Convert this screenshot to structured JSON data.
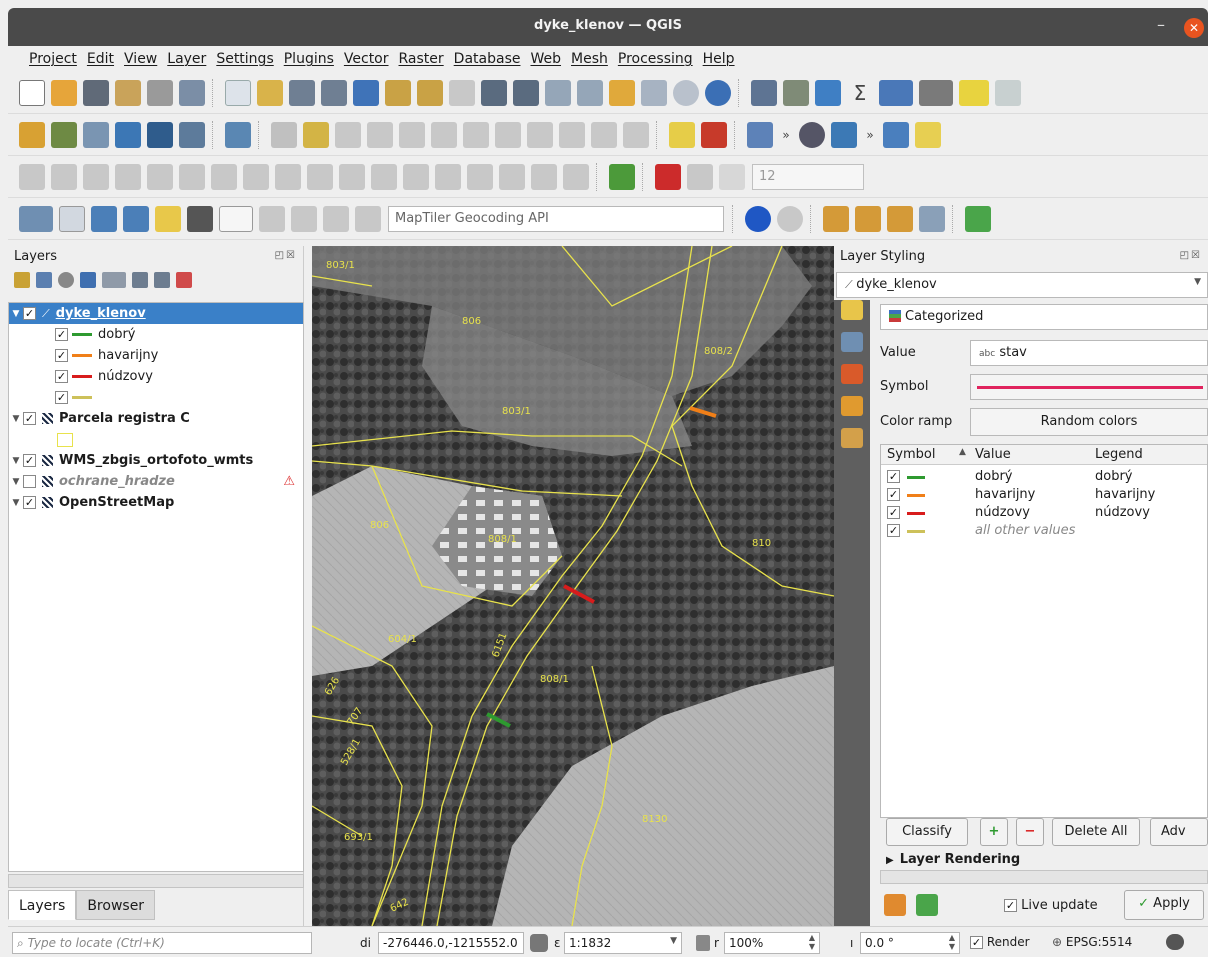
{
  "window": {
    "title": "dyke_klenov — QGIS",
    "minimize": "–",
    "close": "✕"
  },
  "menu": [
    "Project",
    "Edit",
    "View",
    "Layer",
    "Settings",
    "Plugins",
    "Vector",
    "Raster",
    "Database",
    "Web",
    "Mesh",
    "Processing",
    "Help"
  ],
  "toolbar": {
    "geocoder_placeholder": "MapTiler Geocoding API",
    "snap_tolerance": "12",
    "overflow": "»"
  },
  "layers_panel": {
    "title": "Layers",
    "dock_buttons": "◰☒",
    "check": "✓",
    "tree": [
      {
        "label": "dyke_klenov",
        "checked": true,
        "selected": true
      },
      {
        "label": "dobrý",
        "checked": true,
        "color": "#2e9a30"
      },
      {
        "label": "havarijny",
        "checked": true,
        "color": "#f07f18"
      },
      {
        "label": "núdzovy",
        "checked": true,
        "color": "#d81c1c"
      },
      {
        "label": "",
        "checked": true,
        "color": "#cdc15a"
      },
      {
        "label": "Parcela registra C",
        "checked": true
      },
      {
        "label": "WMS_zbgis_ortofoto_wmts",
        "checked": true
      },
      {
        "label": "ochrane_hradze",
        "checked": false,
        "warning": "⚠"
      },
      {
        "label": "OpenStreetMap",
        "checked": true
      }
    ],
    "tabs": [
      "Layers",
      "Browser"
    ]
  },
  "map": {
    "parcel_labels": [
      "803/1",
      "806",
      "803/1",
      "808/2",
      "806",
      "808/1",
      "810",
      "6151",
      "604/1",
      "808/1",
      "626",
      "707",
      "528/1",
      "8130",
      "693/1",
      "642"
    ],
    "segment_colors": {
      "good": "#2e9a30",
      "critical": "#f07f18",
      "emergency": "#d81c1c",
      "parcel": "#e8e24c"
    }
  },
  "styling_panel": {
    "title": "Layer Styling",
    "dock_buttons": "◰☒",
    "layer": "dyke_klenov",
    "renderer": "Categorized",
    "value_label": "Value",
    "value_prefix": "abc",
    "value": "stav",
    "symbol_label": "Symbol",
    "symbol_color": "#e0245e",
    "color_ramp_label": "Color ramp",
    "color_ramp": "Random colors",
    "table_headers": [
      "Symbol",
      "Value",
      "Legend"
    ],
    "categories": [
      {
        "value": "dobrý",
        "legend": "dobrý",
        "color": "#2e9a30"
      },
      {
        "value": "havarijny",
        "legend": "havarijny",
        "color": "#f07f18"
      },
      {
        "value": "núdzovy",
        "legend": "núdzovy",
        "color": "#d81c1c"
      },
      {
        "value": "all other values",
        "legend": "",
        "color": "#cdc15a"
      }
    ],
    "buttons": {
      "classify": "Classify",
      "add": "+",
      "remove": "−",
      "delete_all": "Delete All",
      "advanced": "Adv"
    },
    "layer_rendering": "Layer Rendering",
    "live_update": "Live update",
    "apply": "Apply"
  },
  "statusbar": {
    "locate_placeholder": "Type to locate (Ctrl+K)",
    "coord_label": "di",
    "coordinate": "-276446.0,-1215552.0",
    "scale_label": "ε",
    "scale": "1:1832",
    "mag_label": "r",
    "magnifier": "100%",
    "rot_label": "ı",
    "rotation": "0.0 °",
    "render": "Render",
    "crs": "EPSG:5514"
  }
}
